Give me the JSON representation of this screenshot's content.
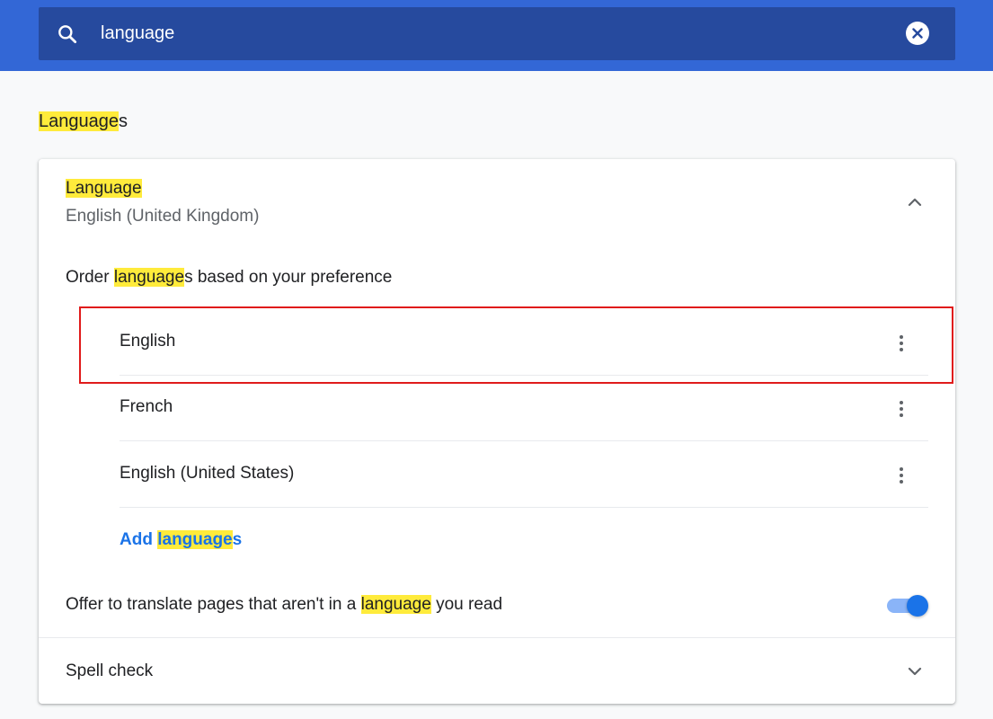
{
  "search": {
    "value": "language",
    "icon": "search-icon",
    "clear_icon": "close-circle-icon"
  },
  "section": {
    "title_highlight": "Language",
    "title_rest": "s"
  },
  "language_panel": {
    "title": "Language",
    "current": "English (United Kingdom)",
    "collapse_icon": "chevron-up-icon",
    "order_label_pre": "Order ",
    "order_label_highlight": "language",
    "order_label_post": "s based on your preference",
    "languages": [
      {
        "name": "English"
      },
      {
        "name": "French"
      },
      {
        "name": "English (United States)"
      }
    ],
    "more_icon": "more-vert-icon",
    "add_pre": "Add ",
    "add_highlight": "language",
    "add_post": "s"
  },
  "translate": {
    "label_pre": "Offer to translate pages that aren't in a ",
    "label_highlight": "language",
    "label_post": " you read",
    "enabled": true
  },
  "spell_check": {
    "label": "Spell check",
    "expand_icon": "chevron-down-icon"
  },
  "colors": {
    "header_bg": "#3367d6",
    "search_bg": "#264a9e",
    "highlight": "#ffeb3b",
    "link": "#1a73e8",
    "annotation_box": "#e01b1b"
  }
}
